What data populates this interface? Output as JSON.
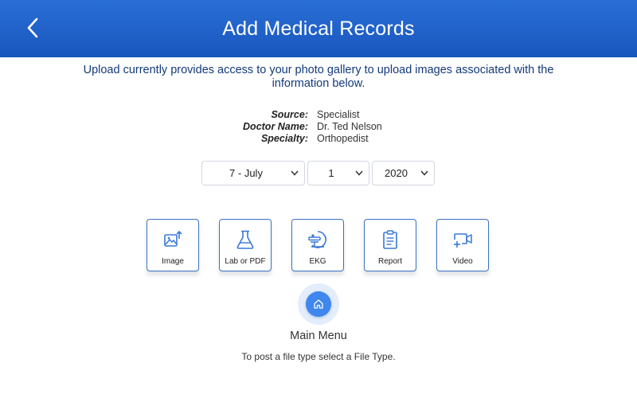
{
  "header": {
    "title": "Add Medical Records",
    "back_icon": "chevron-left-icon"
  },
  "intro": "Upload currently provides access to your photo gallery to upload images associated with the information below.",
  "record_info": {
    "source_label": "Source:",
    "source_value": "Specialist",
    "doctor_label": "Doctor Name:",
    "doctor_value": "Dr. Ted Nelson",
    "specialty_label": "Specialty:",
    "specialty_value": "Orthopedist"
  },
  "date": {
    "month": "7 - July",
    "day": "1",
    "year": "2020"
  },
  "file_types": [
    {
      "label": "Image",
      "icon": "image-upload-icon"
    },
    {
      "label": "Lab or PDF",
      "icon": "flask-icon"
    },
    {
      "label": "EKG",
      "icon": "mri-scanner-icon"
    },
    {
      "label": "Report",
      "icon": "clipboard-icon"
    },
    {
      "label": "Video",
      "icon": "video-add-icon"
    }
  ],
  "main_menu_label": "Main Menu",
  "hint": "To post a file type select a File Type.",
  "colors": {
    "header": "#1f5fc7",
    "accent": "#3f86ee",
    "tile_border": "#3a72c4",
    "intro_text": "#123a7a"
  }
}
